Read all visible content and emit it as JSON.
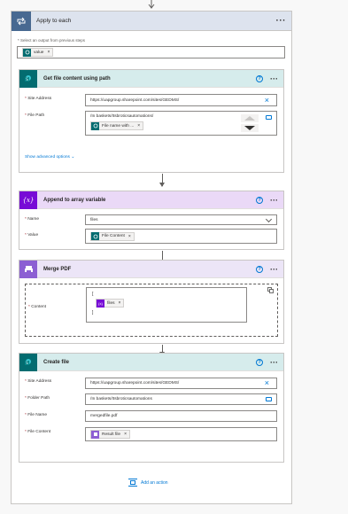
{
  "apply_each": {
    "title": "Apply to each",
    "select_label": "* Select an output from previous steps",
    "token": "value"
  },
  "get_file": {
    "title": "Get file content using path",
    "site_label": "Site Address",
    "site_value": "https://uapgroup.sharepoint.com/sites/GEDMS/",
    "path_label": "File Path",
    "path_value": "/In baskets/Itsbroticsautomations/",
    "path_token": "File name with ...",
    "advanced": "Show advanced options"
  },
  "append": {
    "title": "Append to array variable",
    "name_label": "Name",
    "name_value": "files",
    "value_label": "Value",
    "value_token": "File Content"
  },
  "merge": {
    "title": "Merge PDF",
    "content_label": "Content",
    "open_bracket": "[",
    "close_bracket": "]",
    "token": "files"
  },
  "create": {
    "title": "Create file",
    "site_label": "Site Address",
    "site_value": "https://uapgroup.sharepoint.com/sites/GEDMS/",
    "folder_label": "Folder Path",
    "folder_value": "/In baskets/Itsbroticsautomations",
    "name_label": "File Name",
    "name_value": "mergedfile.pdf",
    "content_label": "File Content",
    "content_token": "Result file"
  },
  "add_action": "Add an action",
  "colors": {
    "loop": "#486991",
    "sharepoint": "#036c70",
    "variable": "#770bd6",
    "merge": "#8c5fd3",
    "header_sp": "#d6ecec",
    "header_var": "#ead9f7"
  }
}
